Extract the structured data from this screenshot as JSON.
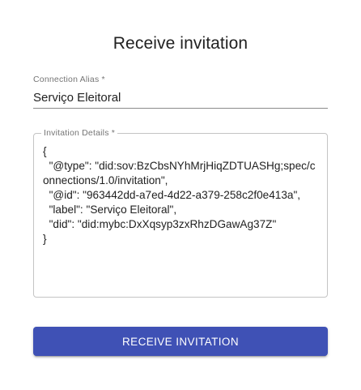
{
  "dialog": {
    "title": "Receive invitation"
  },
  "alias_field": {
    "label": "Connection Alias *",
    "value": "Serviço Eleitoral"
  },
  "details_field": {
    "label": "Invitation Details *",
    "value": "{\n  \"@type\": \"did:sov:BzCbsNYhMrjHiqZDTUASHg;spec/connections/1.0/invitation\",\n  \"@id\": \"963442dd-a7ed-4d22-a379-258c2f0e413a\",\n  \"label\": \"Serviço Eleitoral\",\n  \"did\": \"did:mybc:DxXqsyp3zxRhzDGawAg37Z\"\n}"
  },
  "actions": {
    "receive_label": "RECEIVE INVITATION"
  },
  "colors": {
    "primary": "#3f51b5",
    "outline": "#c4c4c4",
    "label": "#757575"
  }
}
